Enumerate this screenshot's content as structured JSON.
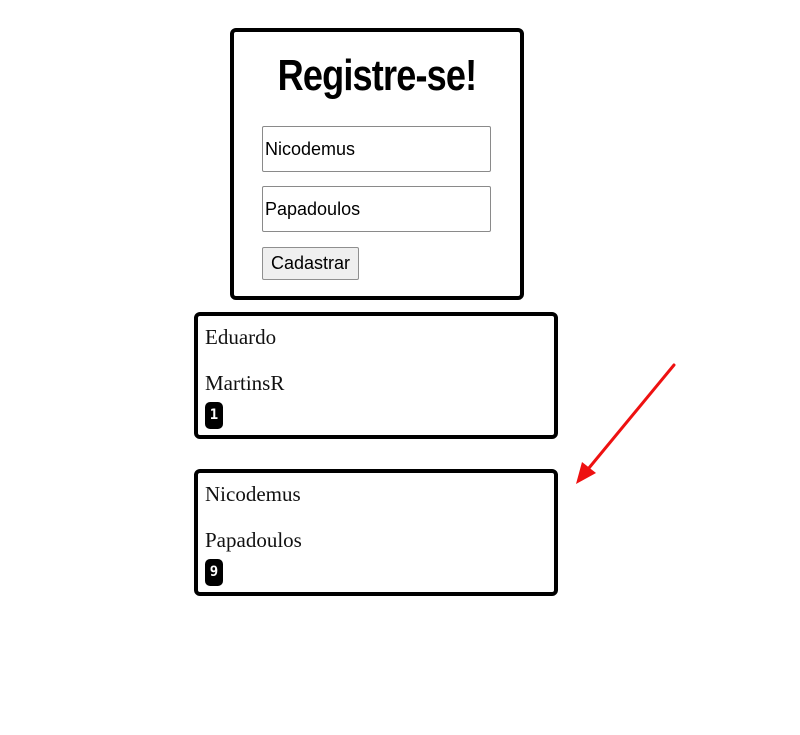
{
  "register_form": {
    "title": "Registre-se!",
    "first_name_value": "Nicodemus",
    "last_name_value": "Papadoulos",
    "submit_label": "Cadastrar"
  },
  "users": [
    {
      "first_name": "Eduardo",
      "last_name": "MartinsR",
      "id": "1"
    },
    {
      "first_name": "Nicodemus",
      "last_name": "Papadoulos",
      "id": "9"
    }
  ],
  "colors": {
    "border": "#000000",
    "badge_bg": "#000000",
    "badge_text": "#ffffff",
    "annotation_arrow": "#ee1111",
    "button_bg": "#efefef"
  },
  "icons": {
    "annotation": "red-arrow-icon"
  }
}
